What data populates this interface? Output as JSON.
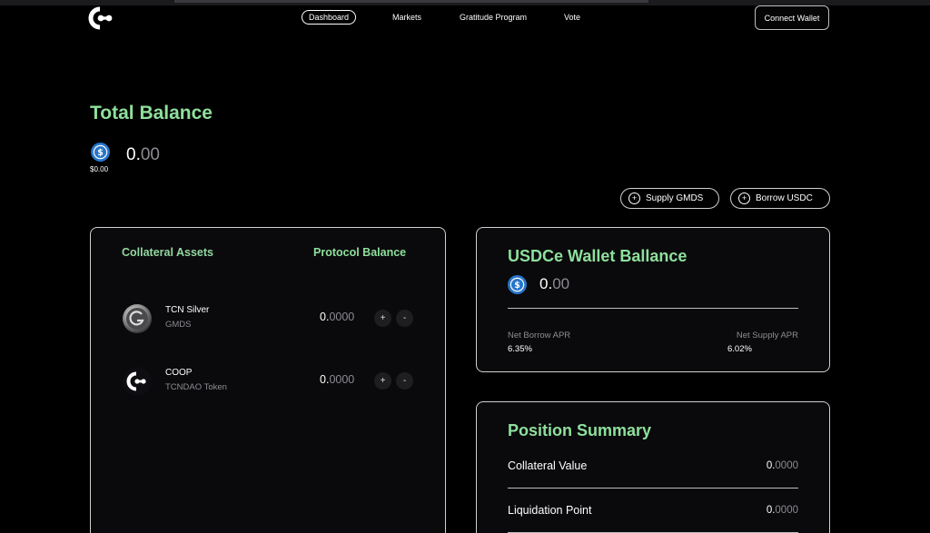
{
  "header": {
    "nav": [
      {
        "label": "Dashboard",
        "active": true
      },
      {
        "label": "Markets",
        "active": false
      },
      {
        "label": "Gratitude Program",
        "active": false
      },
      {
        "label": "Vote",
        "active": false
      }
    ],
    "connect_label": "Connect Wallet"
  },
  "total_balance": {
    "title": "Total Balance",
    "token_value": "$0.00",
    "amount_int": "0.",
    "amount_dec": "00"
  },
  "actions": {
    "supply_label": "Supply GMDS",
    "borrow_label": "Borrow USDC"
  },
  "collateral": {
    "col_assets": "Collateral Assets",
    "col_balance": "Protocol Balance",
    "assets": [
      {
        "name": "TCN Silver",
        "symbol": "GMDS",
        "bal_int": "0.",
        "bal_dec": "0000",
        "icon": "tcn-silver-icon"
      },
      {
        "name": "COOP",
        "symbol": "TCNDAO Token",
        "bal_int": "0.",
        "bal_dec": "0000",
        "icon": "coop-icon"
      }
    ],
    "plus": "+",
    "minus": "-"
  },
  "wallet": {
    "title": "USDCe Wallet Ballance",
    "amount_int": "0.",
    "amount_dec": "00",
    "borrow_apr_label": "Net Borrow APR",
    "borrow_apr": "6.35%",
    "supply_apr_label": "Net Supply APR",
    "supply_apr": "6.02%"
  },
  "position": {
    "title": "Position Summary",
    "collateral_label": "Collateral Value",
    "collateral_int": "0.",
    "collateral_dec": "0000",
    "liquidation_label": "Liquidation Point",
    "liquidation_int": "0.",
    "liquidation_dec": "0000"
  },
  "colors": {
    "accent_green": "#8ee09c",
    "usdc_blue": "#2775ca",
    "background": "#000000"
  }
}
